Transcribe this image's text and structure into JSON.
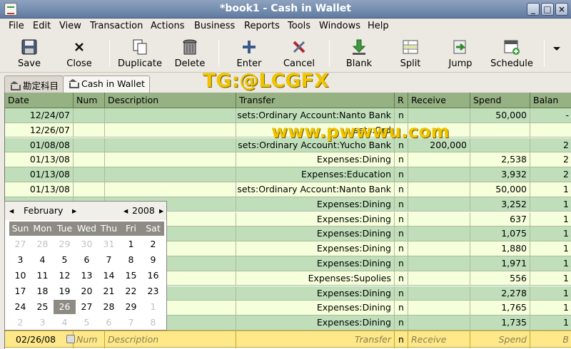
{
  "window": {
    "title": "*book1 - Cash in Wallet",
    "min": "_",
    "max": "□",
    "close": "×"
  },
  "menu": [
    "File",
    "Edit",
    "View",
    "Transaction",
    "Actions",
    "Business",
    "Reports",
    "Tools",
    "Windows",
    "Help"
  ],
  "toolbar": [
    "Save",
    "Close",
    "Duplicate",
    "Delete",
    "Enter",
    "Cancel",
    "Blank",
    "Split",
    "Jump",
    "Schedule"
  ],
  "tabs": [
    "勘定科目",
    "Cash in Wallet"
  ],
  "columns": [
    "Date",
    "Num",
    "Description",
    "Transfer",
    "R",
    "Receive",
    "Spend",
    "Balan"
  ],
  "rows": [
    {
      "date": "12/24/07",
      "transfer": "sets:Ordinary Account:Nanto Bank",
      "r": "n",
      "receive": "",
      "spend": "50,000",
      "balance": "-"
    },
    {
      "date": "12/26/07",
      "transfer": "sets:Ord",
      "r": "",
      "receive": "",
      "spend": "",
      "balance": ""
    },
    {
      "date": "01/08/08",
      "transfer": "sets:Ordinary Account:Yucho Bank",
      "r": "n",
      "receive": "200,000",
      "spend": "",
      "balance": "2"
    },
    {
      "date": "01/13/08",
      "transfer": "Expenses:Dining",
      "r": "n",
      "receive": "",
      "spend": "2,538",
      "balance": "2"
    },
    {
      "date": "01/13/08",
      "transfer": "Expenses:Education",
      "r": "n",
      "receive": "",
      "spend": "3,932",
      "balance": "2"
    },
    {
      "date": "01/13/08",
      "transfer": "sets:Ordinary Account:Nanto Bank",
      "r": "n",
      "receive": "",
      "spend": "50,000",
      "balance": "1"
    },
    {
      "date": "",
      "transfer": "Expenses:Dining",
      "r": "n",
      "receive": "",
      "spend": "3,252",
      "balance": "1"
    },
    {
      "date": "",
      "transfer": "Expenses:Dining",
      "r": "n",
      "receive": "",
      "spend": "637",
      "balance": "1"
    },
    {
      "date": "",
      "transfer": "Expenses:Dining",
      "r": "n",
      "receive": "",
      "spend": "1,075",
      "balance": "1"
    },
    {
      "date": "",
      "transfer": "Expenses:Dining",
      "r": "n",
      "receive": "",
      "spend": "1,880",
      "balance": "1"
    },
    {
      "date": "",
      "transfer": "Expenses:Dining",
      "r": "n",
      "receive": "",
      "spend": "1,971",
      "balance": "1"
    },
    {
      "date": "",
      "transfer": "Expenses:Supolies",
      "r": "n",
      "receive": "",
      "spend": "556",
      "balance": "1"
    },
    {
      "date": "",
      "transfer": "Expenses:Dining",
      "r": "n",
      "receive": "",
      "spend": "2,278",
      "balance": "1"
    },
    {
      "date": "",
      "transfer": "Expenses:Dining",
      "r": "n",
      "receive": "",
      "spend": "1,765",
      "balance": "1"
    },
    {
      "date": "",
      "transfer": "Expenses:Dining",
      "r": "n",
      "receive": "",
      "spend": "1,735",
      "balance": "1"
    }
  ],
  "blank": {
    "date": "02/26/08",
    "num": "Num",
    "description": "Description",
    "transfer": "Transfer",
    "r": "n",
    "receive": "Receive",
    "spend": "Spend",
    "balance": "B"
  },
  "calendar": {
    "month": "February",
    "year": "2008",
    "prev": "◂",
    "next": "▸",
    "weekdays": [
      "Sun",
      "Mon",
      "Tue",
      "Wed",
      "Thu",
      "Fri",
      "Sat"
    ],
    "weeks": [
      [
        "27",
        "28",
        "29",
        "30",
        "31",
        "1",
        "2"
      ],
      [
        "3",
        "4",
        "5",
        "6",
        "7",
        "8",
        "9"
      ],
      [
        "10",
        "11",
        "12",
        "13",
        "14",
        "15",
        "16"
      ],
      [
        "17",
        "18",
        "19",
        "20",
        "21",
        "22",
        "23"
      ],
      [
        "24",
        "25",
        "26",
        "27",
        "28",
        "29",
        "1"
      ],
      [
        "2",
        "3",
        "4",
        "5",
        "6",
        "7",
        "8"
      ]
    ],
    "selected": "26"
  },
  "watermarks": [
    "TG:@LCGFX",
    "www.pwwwu.com"
  ]
}
